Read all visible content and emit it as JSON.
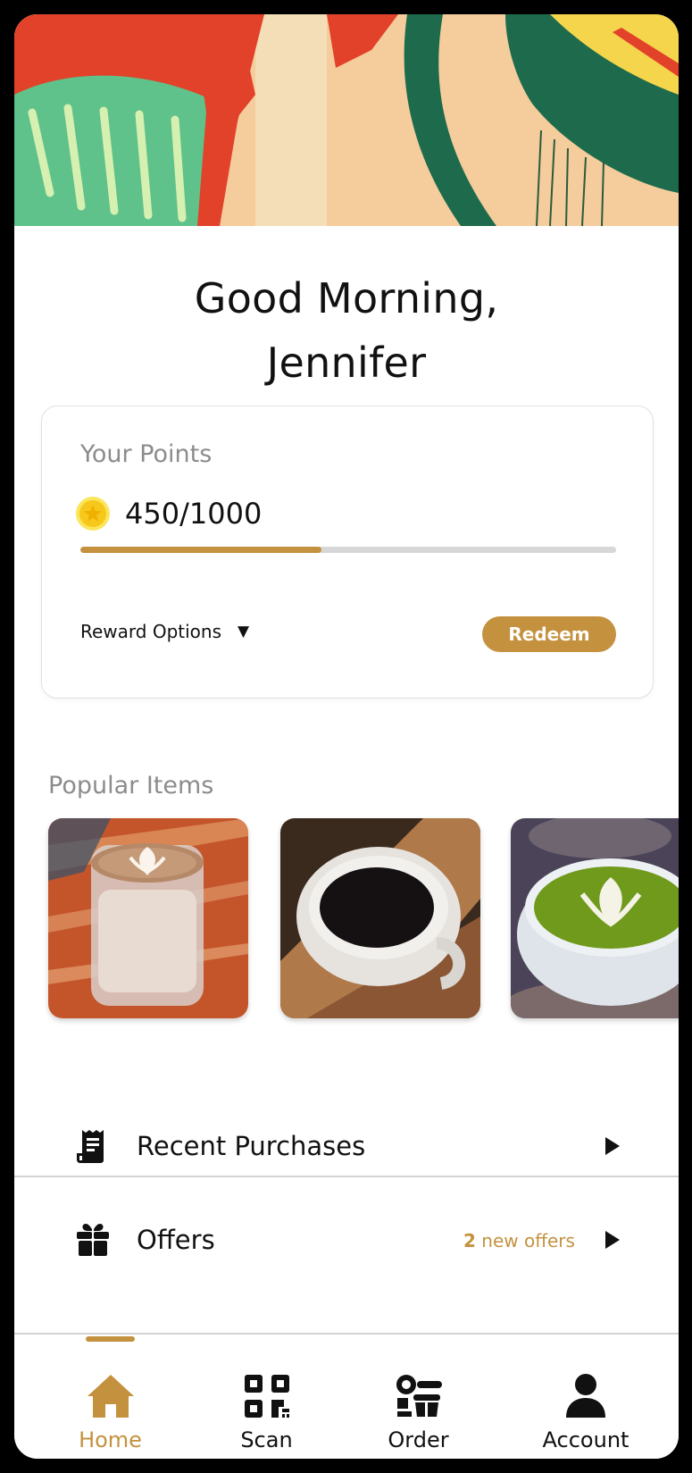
{
  "greeting": {
    "line1": "Good Morning,",
    "line2": "Jennifer"
  },
  "points": {
    "label": "Your Points",
    "value_text": "450/1000",
    "current": 450,
    "max": 1000,
    "progress_fraction": 0.45,
    "reward_options_label": "Reward Options",
    "reward_options_icon": "dropdown-triangle-icon",
    "redeem_label": "Redeem"
  },
  "popular": {
    "title": "Popular Items",
    "items": [
      {
        "icon": "latte-image"
      },
      {
        "icon": "black-coffee-image"
      },
      {
        "icon": "matcha-latte-image"
      }
    ]
  },
  "list": {
    "recent_purchases": {
      "label": "Recent Purchases",
      "icon": "receipt-icon"
    },
    "offers": {
      "label": "Offers",
      "icon": "gift-icon",
      "badge_count": "2",
      "badge_text": " new offers"
    }
  },
  "nav": {
    "items": [
      {
        "label": "Home",
        "icon": "home-icon",
        "active": true
      },
      {
        "label": "Scan",
        "icon": "qr-code-icon",
        "active": false
      },
      {
        "label": "Order",
        "icon": "order-icon",
        "active": false
      },
      {
        "label": "Account",
        "icon": "person-icon",
        "active": false
      }
    ]
  },
  "colors": {
    "accent": "#c4923f",
    "text": "#111111",
    "muted": "#8c8c8c",
    "track": "#d7d7d7",
    "coin": "#f7d21c"
  }
}
